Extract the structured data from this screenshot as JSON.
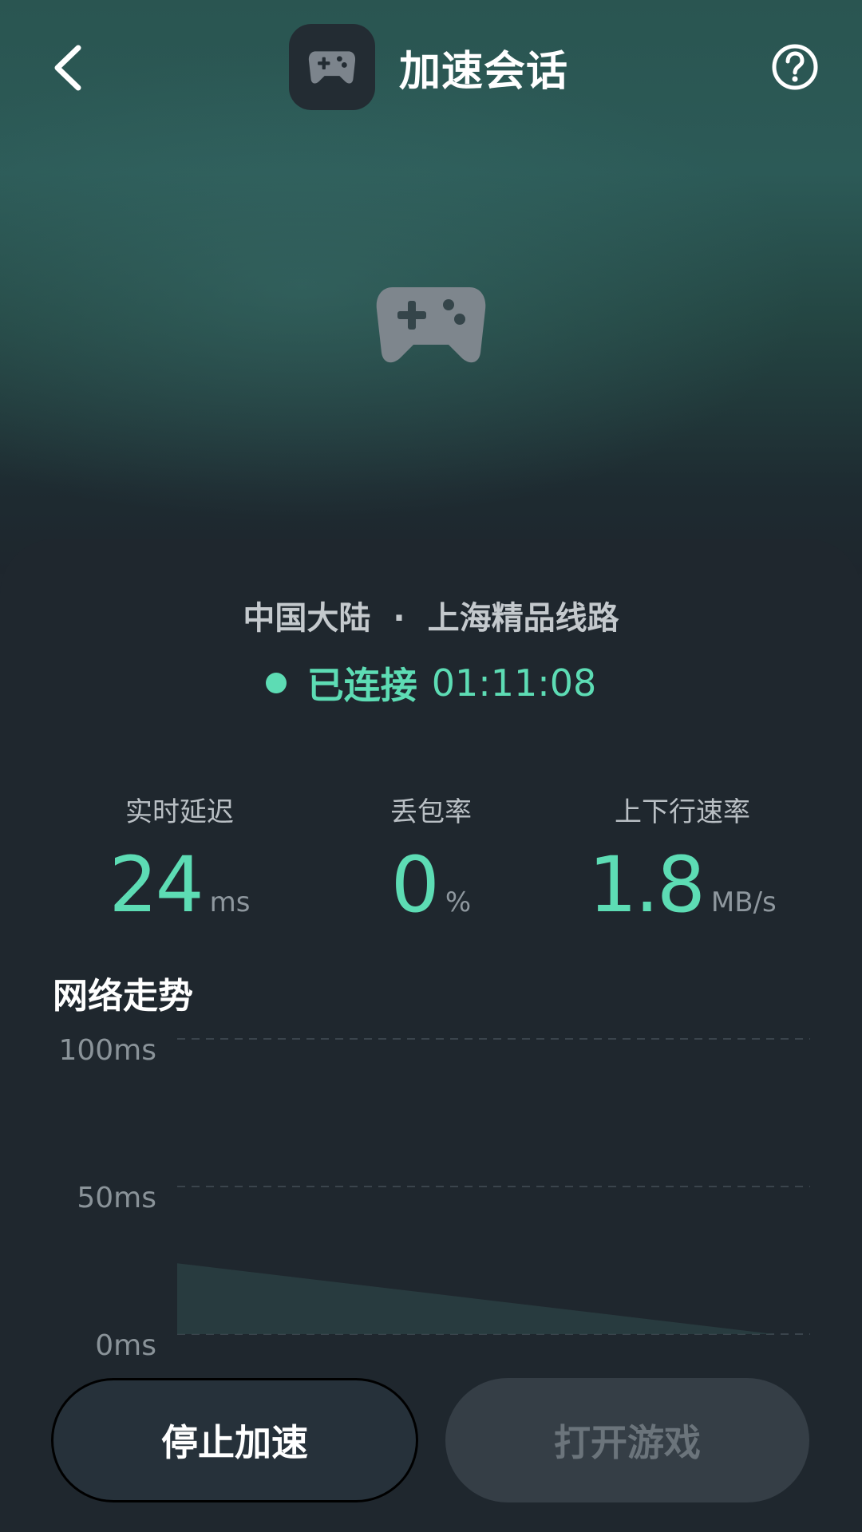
{
  "header": {
    "title": "加速会话"
  },
  "session": {
    "region": "中国大陆",
    "separator": "·",
    "route": "上海精品线路",
    "status_label": "已连接",
    "elapsed": "01:11:08"
  },
  "stats": [
    {
      "label": "实时延迟",
      "value": "24",
      "unit": "ms"
    },
    {
      "label": "丢包率",
      "value": "0",
      "unit": "%"
    },
    {
      "label": "上下行速率",
      "value": "1.8",
      "unit": "MB/s"
    }
  ],
  "trend": {
    "title": "网络走势"
  },
  "chart_data": {
    "type": "area",
    "ylim": [
      0,
      100
    ],
    "y_ticks": [
      "100ms",
      "50ms",
      "0ms"
    ],
    "grid": true,
    "series": [
      {
        "x": [
          0,
          1
        ],
        "values": [
          24,
          0
        ]
      }
    ]
  },
  "actions": {
    "stop_label": "停止加速",
    "open_label": "打开游戏"
  },
  "colors": {
    "accent": "#5ddcb4",
    "panel": "#1f272e",
    "hero_top": "#2a5551"
  },
  "icons": {
    "back": "chevron-left-icon",
    "help": "question-circle-icon",
    "app": "gamepad-icon"
  }
}
